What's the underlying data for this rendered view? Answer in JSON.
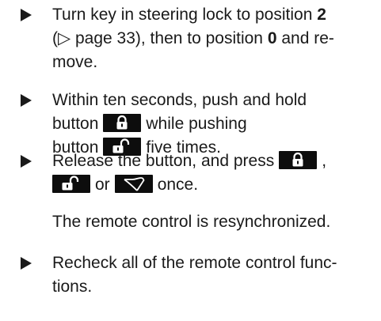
{
  "steps": [
    {
      "lines": [
        [
          "Turn key in steering lock to position ",
          "2"
        ],
        [
          "(▷ page 33), then to position ",
          "0",
          " and re-"
        ],
        [
          "move."
        ]
      ]
    },
    {
      "lines": [
        [
          "Within ten seconds, push and hold"
        ],
        [
          "button",
          "while pushing"
        ],
        [
          "button",
          "five times."
        ]
      ]
    },
    {
      "lines": [
        [
          "Release the button, and press",
          ","
        ],
        [
          "or",
          "once."
        ]
      ]
    },
    {
      "lines": [
        [
          "Recheck all of the remote control func-"
        ],
        [
          "tions."
        ]
      ]
    }
  ],
  "result_text": "The remote control is resynchronized.",
  "icons": {
    "lock": "lock-icon",
    "unlock": "unlock-icon",
    "trunk": "trunk-icon",
    "bullet": "triangle-bullet-icon"
  },
  "colors": {
    "text": "#1a1a1a",
    "key_background": "#0d0d0d",
    "key_symbol": "#ffffff"
  }
}
